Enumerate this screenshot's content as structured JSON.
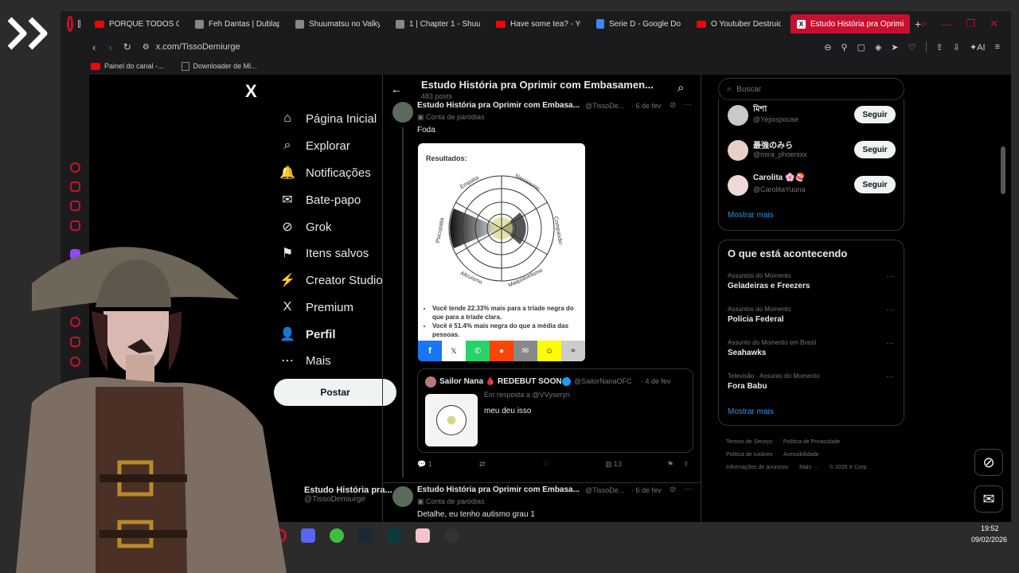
{
  "browser": {
    "tabs": [
      {
        "label": "PORQUE TODOS OD",
        "icon": "youtube-icon"
      },
      {
        "label": "Feh Dantas | Dublapé",
        "icon": "page-icon"
      },
      {
        "label": "Shuumatsu no Valkyr",
        "icon": "page-icon"
      },
      {
        "label": "1 | Chapter 1 - Shuum",
        "icon": "page-icon"
      },
      {
        "label": "Have some tea? - Yo",
        "icon": "youtube-icon"
      },
      {
        "label": "Serie D - Google Doc",
        "icon": "docs-icon"
      },
      {
        "label": "O Youtuber Destruido",
        "icon": "youtube-icon"
      },
      {
        "label": "Estudo História pra Oprimi",
        "icon": "x-icon",
        "active": true
      }
    ],
    "new_tab": "+",
    "url": "x.com/TissoDemiurge",
    "ai_label": "AI",
    "bookmarks": [
      "Painel do canal -...",
      "Downloader de Mi..."
    ],
    "accent": "#c8102e"
  },
  "left_nav": {
    "logo": "X",
    "items": [
      {
        "label": "Página Inicial",
        "icon": "home-icon",
        "glyph": "⌂"
      },
      {
        "label": "Explorar",
        "icon": "search-icon",
        "glyph": "⌕"
      },
      {
        "label": "Notificações",
        "icon": "bell-icon",
        "glyph": "🔔"
      },
      {
        "label": "Bate-papo",
        "icon": "chat-icon",
        "glyph": "✉"
      },
      {
        "label": "Grok",
        "icon": "grok-icon",
        "glyph": "⊘"
      },
      {
        "label": "Itens salvos",
        "icon": "bookmark-icon",
        "glyph": "⚑"
      },
      {
        "label": "Creator Studio",
        "icon": "creator-icon",
        "glyph": "⚡"
      },
      {
        "label": "Premium",
        "icon": "x-premium-icon",
        "glyph": "X"
      },
      {
        "label": "Perfil",
        "icon": "person-icon",
        "glyph": "👤"
      },
      {
        "label": "Mais",
        "icon": "more-icon",
        "glyph": "⋯"
      }
    ],
    "post_button": "Postar",
    "account_name": "Estudo História pra...",
    "account_handle": "@TissoDemiurge"
  },
  "header": {
    "title": "Estudo História pra Oprimir com Embasamen...",
    "posts_count": "483 posts"
  },
  "posts": [
    {
      "name": "Estudo História pra Oprimir com Embasa...",
      "handle": "@TissoDe...",
      "date": "· 6 de fev",
      "tag": "Conta de paródias",
      "text": "Foda",
      "image": {
        "title": "Resultados:",
        "labels": [
          "Narcisismo",
          "Compaixão",
          "Maquiavelismo",
          "Altruísmo",
          "Psicopatia",
          "Empatia"
        ],
        "bullets": [
          "Você tende 22.33% mais para a tríade negra do que para a tríade clara.",
          "Você é 51.4% mais negra do que a média das pessoas."
        ]
      },
      "quote": {
        "name": "Sailor Nana 🩸 REDEBUT SOON",
        "handle": "@SailorNanaOFC",
        "date": "· 4 de fev",
        "reply_to": "Em resposta a @VVyseryn",
        "text": "meu deu isso"
      },
      "stats": {
        "replies": "1",
        "retweets": "",
        "likes": "",
        "views": "13"
      }
    },
    {
      "name": "Estudo História pra Oprimir com Embasa...",
      "handle": "@TissoDe...",
      "date": "· 6 de fev",
      "tag": "Conta de paródias",
      "text": "Detalhe, eu tenho autismo grau 1"
    }
  ],
  "right": {
    "search_placeholder": "Buscar",
    "follow_suggestions": [
      {
        "name": "মিশা",
        "handle": "@Yejisspouse",
        "button": "Seguir"
      },
      {
        "name": "最強のみら",
        "handle": "@mira_phoenixx",
        "button": "Seguir"
      },
      {
        "name": "Carolita 🌸🍣",
        "handle": "@CarolitaYuuna",
        "button": "Seguir"
      }
    ],
    "show_more_1": "Mostrar mais",
    "trending_title": "O que está acontecendo",
    "trends": [
      {
        "context": "Assuntos do Momento",
        "topic": "Geladeiras e Freezers"
      },
      {
        "context": "Assuntos do Momento",
        "topic": "Polícia Federal"
      },
      {
        "context": "Assunto do Momento em Brasil",
        "topic": "Seahawks"
      },
      {
        "context": "Televisão · Assunto do Momento",
        "topic": "Fora Babu"
      }
    ],
    "show_more_2": "Mostrar mais",
    "footer": [
      "Termos de Serviço",
      "Política de Privacidade",
      "Política de cookies",
      "Acessibilidade",
      "Informações de anúncios",
      "Mais ···",
      "© 2026 X Corp."
    ]
  },
  "taskbar": {
    "time": "19:52",
    "date": "09/02/2026"
  }
}
